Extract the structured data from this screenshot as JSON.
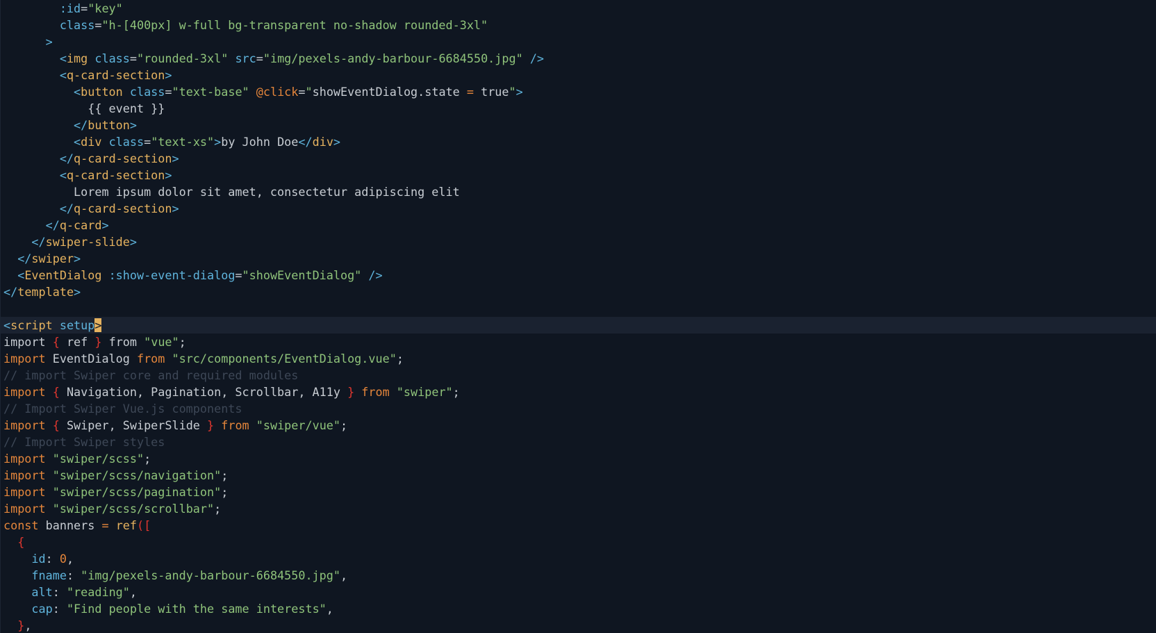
{
  "theme": {
    "background": "#0f1621",
    "current_line": "#1a2230",
    "tag": "#e5b25f",
    "punct": "#5fb4dc",
    "string": "#8fc37a",
    "keyword": "#e5863b",
    "comment": "#3d4756",
    "bracket": "#e0372f",
    "text": "#c8cdd3"
  },
  "editor": {
    "cursor_line": 19,
    "lines": [
      [
        [
          "attr",
          "        :id"
        ],
        [
          "txt",
          "="
        ],
        [
          "str",
          "\"key\""
        ]
      ],
      [
        [
          "attr",
          "        class"
        ],
        [
          "txt",
          "="
        ],
        [
          "str",
          "\"h-[400px] w-full bg-transparent no-shadow rounded-3xl\""
        ]
      ],
      [
        [
          "punct",
          "      >"
        ]
      ],
      [
        [
          "punct",
          "        <"
        ],
        [
          "tag",
          "img"
        ],
        [
          "txt",
          " "
        ],
        [
          "attr",
          "class"
        ],
        [
          "txt",
          "="
        ],
        [
          "str",
          "\"rounded-3xl\""
        ],
        [
          "txt",
          " "
        ],
        [
          "attr",
          "src"
        ],
        [
          "txt",
          "="
        ],
        [
          "str",
          "\"img/pexels-andy-barbour-6684550.jpg\""
        ],
        [
          "txt",
          " "
        ],
        [
          "punct",
          "/>"
        ]
      ],
      [
        [
          "punct",
          "        <"
        ],
        [
          "tag",
          "q-card-section"
        ],
        [
          "punct",
          ">"
        ]
      ],
      [
        [
          "punct",
          "          <"
        ],
        [
          "tag",
          "button"
        ],
        [
          "txt",
          " "
        ],
        [
          "attr",
          "class"
        ],
        [
          "txt",
          "="
        ],
        [
          "str",
          "\"text-base\""
        ],
        [
          "txt",
          " "
        ],
        [
          "at",
          "@click"
        ],
        [
          "txt",
          "="
        ],
        [
          "str",
          "\""
        ],
        [
          "txt",
          "showEventDialog.state "
        ],
        [
          "kw",
          "="
        ],
        [
          "txt",
          " true"
        ],
        [
          "str",
          "\""
        ],
        [
          "punct",
          ">"
        ]
      ],
      [
        [
          "txt",
          "            {{ event }}"
        ]
      ],
      [
        [
          "punct",
          "          </"
        ],
        [
          "tag",
          "button"
        ],
        [
          "punct",
          ">"
        ]
      ],
      [
        [
          "punct",
          "          <"
        ],
        [
          "tag",
          "div"
        ],
        [
          "txt",
          " "
        ],
        [
          "attr",
          "class"
        ],
        [
          "txt",
          "="
        ],
        [
          "str",
          "\"text-xs\""
        ],
        [
          "punct",
          ">"
        ],
        [
          "txt",
          "by John Doe"
        ],
        [
          "punct",
          "</"
        ],
        [
          "tag",
          "div"
        ],
        [
          "punct",
          ">"
        ]
      ],
      [
        [
          "punct",
          "        </"
        ],
        [
          "tag",
          "q-card-section"
        ],
        [
          "punct",
          ">"
        ]
      ],
      [
        [
          "punct",
          "        <"
        ],
        [
          "tag",
          "q-card-section"
        ],
        [
          "punct",
          ">"
        ]
      ],
      [
        [
          "txt",
          "          Lorem ipsum dolor sit amet, consectetur adipiscing elit"
        ]
      ],
      [
        [
          "punct",
          "        </"
        ],
        [
          "tag",
          "q-card-section"
        ],
        [
          "punct",
          ">"
        ]
      ],
      [
        [
          "punct",
          "      </"
        ],
        [
          "tag",
          "q-card"
        ],
        [
          "punct",
          ">"
        ]
      ],
      [
        [
          "punct",
          "    </"
        ],
        [
          "tag",
          "swiper-slide"
        ],
        [
          "punct",
          ">"
        ]
      ],
      [
        [
          "punct",
          "  </"
        ],
        [
          "tag",
          "swiper"
        ],
        [
          "punct",
          ">"
        ]
      ],
      [
        [
          "punct",
          "  <"
        ],
        [
          "ctag",
          "EventDialog"
        ],
        [
          "txt",
          " "
        ],
        [
          "attr",
          ":show-event-dialog"
        ],
        [
          "txt",
          "="
        ],
        [
          "str",
          "\"showEventDialog\""
        ],
        [
          "txt",
          " "
        ],
        [
          "punct",
          "/>"
        ]
      ],
      [
        [
          "punct",
          "</"
        ],
        [
          "tag",
          "template"
        ],
        [
          "punct",
          ">"
        ]
      ],
      [
        [
          "txt",
          ""
        ]
      ],
      [
        [
          "punct",
          "<"
        ],
        [
          "tag",
          "script"
        ],
        [
          "txt",
          " "
        ],
        [
          "attr",
          "setup"
        ],
        [
          "cursor",
          ">"
        ]
      ],
      [
        [
          "txt",
          "import "
        ],
        [
          "br",
          "{"
        ],
        [
          "txt",
          " ref "
        ],
        [
          "br",
          "}"
        ],
        [
          "txt",
          " from "
        ],
        [
          "str",
          "\"vue\""
        ],
        [
          "txt",
          ";"
        ]
      ],
      [
        [
          "kw",
          "import"
        ],
        [
          "txt",
          " EventDialog "
        ],
        [
          "kw",
          "from"
        ],
        [
          "txt",
          " "
        ],
        [
          "str",
          "\"src/components/EventDialog.vue\""
        ],
        [
          "txt",
          ";"
        ]
      ],
      [
        [
          "cmt",
          "// import Swiper core and required modules"
        ]
      ],
      [
        [
          "kw",
          "import"
        ],
        [
          "txt",
          " "
        ],
        [
          "br",
          "{"
        ],
        [
          "txt",
          " Navigation, Pagination, Scrollbar, A11y "
        ],
        [
          "br",
          "}"
        ],
        [
          "txt",
          " "
        ],
        [
          "kw",
          "from"
        ],
        [
          "txt",
          " "
        ],
        [
          "str",
          "\"swiper\""
        ],
        [
          "txt",
          ";"
        ]
      ],
      [
        [
          "cmt",
          "// Import Swiper Vue.js components"
        ]
      ],
      [
        [
          "kw",
          "import"
        ],
        [
          "txt",
          " "
        ],
        [
          "br",
          "{"
        ],
        [
          "txt",
          " Swiper, SwiperSlide "
        ],
        [
          "br",
          "}"
        ],
        [
          "txt",
          " "
        ],
        [
          "kw",
          "from"
        ],
        [
          "txt",
          " "
        ],
        [
          "str",
          "\"swiper/vue\""
        ],
        [
          "txt",
          ";"
        ]
      ],
      [
        [
          "cmt",
          "// Import Swiper styles"
        ]
      ],
      [
        [
          "kw",
          "import"
        ],
        [
          "txt",
          " "
        ],
        [
          "str",
          "\"swiper/scss\""
        ],
        [
          "txt",
          ";"
        ]
      ],
      [
        [
          "kw",
          "import"
        ],
        [
          "txt",
          " "
        ],
        [
          "str",
          "\"swiper/scss/navigation\""
        ],
        [
          "txt",
          ";"
        ]
      ],
      [
        [
          "kw",
          "import"
        ],
        [
          "txt",
          " "
        ],
        [
          "str",
          "\"swiper/scss/pagination\""
        ],
        [
          "txt",
          ";"
        ]
      ],
      [
        [
          "kw",
          "import"
        ],
        [
          "txt",
          " "
        ],
        [
          "str",
          "\"swiper/scss/scrollbar\""
        ],
        [
          "txt",
          ";"
        ]
      ],
      [
        [
          "kw",
          "const"
        ],
        [
          "txt",
          " banners "
        ],
        [
          "kw",
          "="
        ],
        [
          "txt",
          " "
        ],
        [
          "fn",
          "ref"
        ],
        [
          "br",
          "(["
        ]
      ],
      [
        [
          "br",
          "  {"
        ]
      ],
      [
        [
          "key",
          "    id"
        ],
        [
          "txt",
          ": "
        ],
        [
          "num",
          "0"
        ],
        [
          "txt",
          ","
        ]
      ],
      [
        [
          "key",
          "    fname"
        ],
        [
          "txt",
          ": "
        ],
        [
          "str",
          "\"img/pexels-andy-barbour-6684550.jpg\""
        ],
        [
          "txt",
          ","
        ]
      ],
      [
        [
          "key",
          "    alt"
        ],
        [
          "txt",
          ": "
        ],
        [
          "str",
          "\"reading\""
        ],
        [
          "txt",
          ","
        ]
      ],
      [
        [
          "key",
          "    cap"
        ],
        [
          "txt",
          ": "
        ],
        [
          "str",
          "\"Find people with the same interests\""
        ],
        [
          "txt",
          ","
        ]
      ],
      [
        [
          "br",
          "  }"
        ],
        [
          "txt",
          ","
        ]
      ]
    ]
  }
}
